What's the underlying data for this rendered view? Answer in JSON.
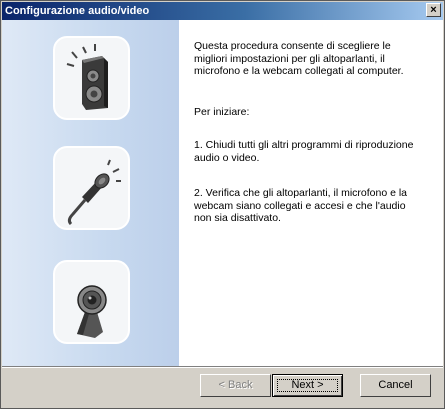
{
  "window": {
    "title": "Configurazione audio/video",
    "close_label": "×"
  },
  "sidebar": {
    "icons": [
      "speaker-icon",
      "microphone-icon",
      "webcam-icon"
    ]
  },
  "main": {
    "intro": "Questa procedura consente di scegliere le migliori impostazioni per gli altoparlanti, il microfono e la webcam collegati al computer.",
    "start": "Per iniziare:",
    "step1": "1. Chiudi tutti gli altri programmi di riproduzione audio o video.",
    "step2": "2. Verifica che gli altoparlanti, il microfono e la webcam siano collegati e accesi e che l'audio non sia disattivato."
  },
  "buttons": {
    "back": "< Back",
    "next": "Next >",
    "cancel": "Cancel"
  },
  "colors": {
    "titlebar_start": "#0a246a",
    "titlebar_end": "#a6caf0",
    "sidebar": "#c7d9ef",
    "face": "#d4d0c8"
  }
}
